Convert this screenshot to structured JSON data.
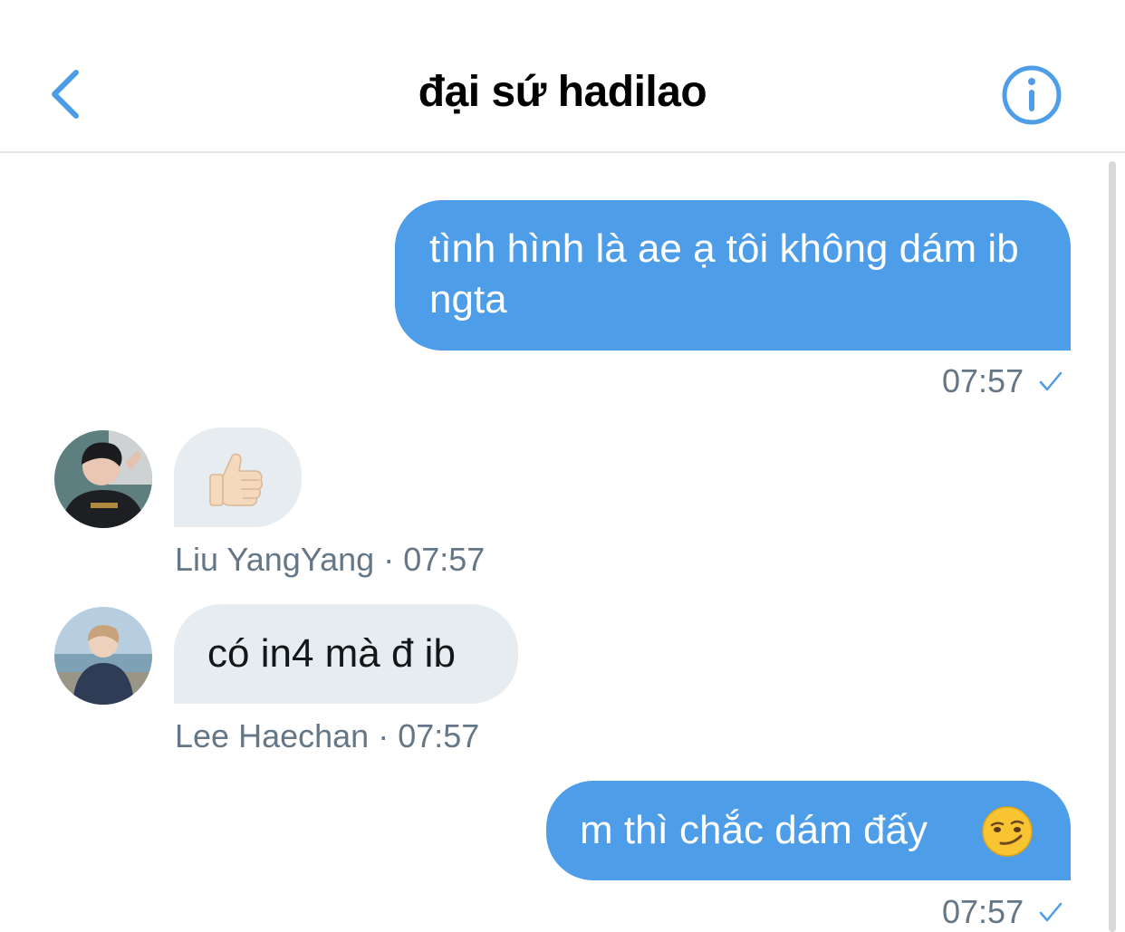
{
  "header": {
    "title": "đại sứ hadilao",
    "back_icon": "chevron-left-icon",
    "info_icon": "info-circle-icon",
    "accent_color": "#4e9de8"
  },
  "messages": [
    {
      "direction": "outgoing",
      "text": "tình hình là ae ạ tôi không dám ib ngta",
      "time": "07:57",
      "status_icon": "check-icon"
    },
    {
      "direction": "incoming",
      "emoji": "thumbs-up-icon",
      "sender": "Liu YangYang",
      "separator": "·",
      "time": "07:57"
    },
    {
      "direction": "incoming",
      "text": "có in4 mà đ ib",
      "sender": "Lee Haechan",
      "separator": "·",
      "time": "07:57"
    },
    {
      "direction": "outgoing",
      "text": "m thì chắc dám đấy",
      "emoji": "smirking-face-icon",
      "time": "07:57",
      "status_icon": "check-icon"
    }
  ],
  "colors": {
    "outgoing_bubble": "#4e9de8",
    "incoming_bubble": "#e6ecf0",
    "meta_text": "#657786"
  }
}
